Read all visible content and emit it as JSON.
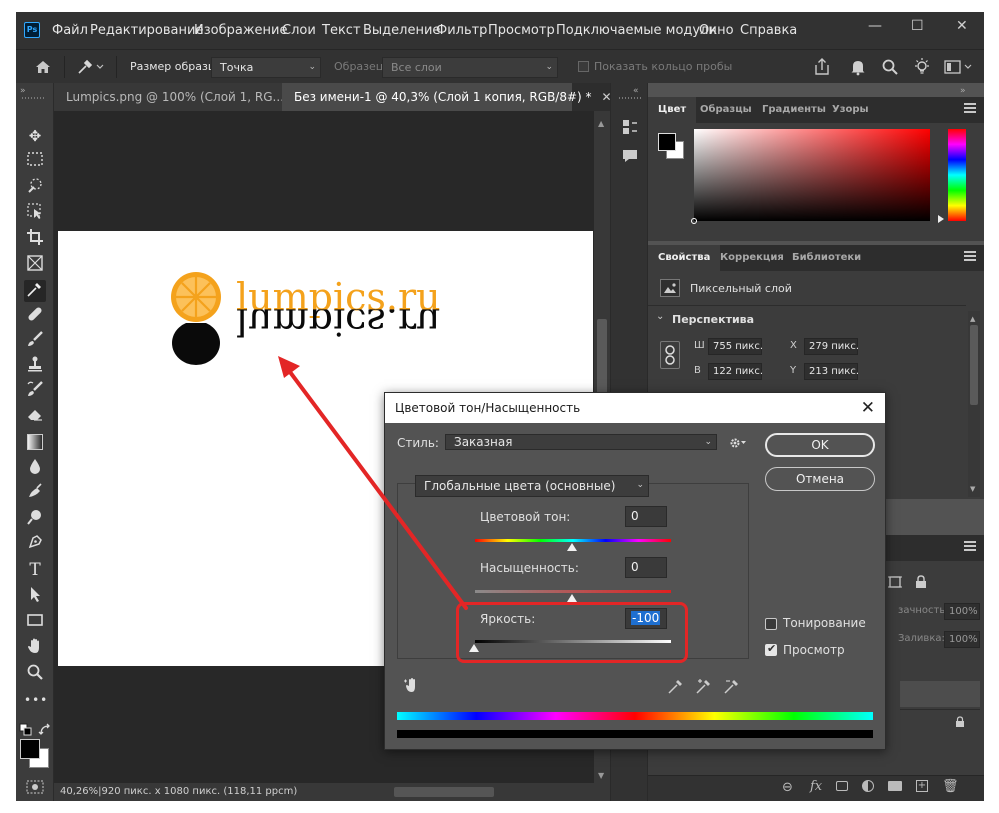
{
  "menubar": {
    "app_icon": "Ps",
    "items": [
      "Файл",
      "Редактирование",
      "Изображение",
      "Слои",
      "Текст",
      "Выделение",
      "Фильтр",
      "Просмотр",
      "Подключаемые модули",
      "Окно",
      "Справка"
    ],
    "window_controls": [
      "—",
      "☐",
      "✕"
    ]
  },
  "options": {
    "sample_size_label": "Размер образца:",
    "sample_size_value": "Точка",
    "sample_label": "Образец:",
    "sample_value": "Все слои",
    "show_ring_label": "Показать кольцо пробы"
  },
  "tabs": [
    {
      "label": "Lumpics.png @ 100% (Слой 1, RG...",
      "close": "✕"
    },
    {
      "label": "Без имени-1 @ 40,3% (Слой 1 копия, RGB/8#) *",
      "close": "✕"
    }
  ],
  "canvas": {
    "logo_text": "lumpics.ru",
    "logo_color": "#f4a21c",
    "mirror_color": "#0a0a0a"
  },
  "statusbar": {
    "text": "40,26%|920 пикс. x 1080 пикс. (118,11 ppcm)"
  },
  "color_panel": {
    "tabs": [
      "Цвет",
      "Образцы",
      "Градиенты",
      "Узоры"
    ]
  },
  "properties_panel": {
    "tabs": [
      "Свойства",
      "Коррекция",
      "Библиотеки"
    ],
    "layer_type": "Пиксельный слой",
    "section": "Перспектива",
    "w_label": "Ш",
    "w_value": "755 пикс.",
    "x_label": "X",
    "x_value": "279 пикс.",
    "h_label": "В",
    "h_value": "122 пикс.",
    "y_label": "Y",
    "y_value": "213 пикс."
  },
  "layers_panel": {
    "opacity_label": "зачность:",
    "opacity_value": "100%",
    "fill_label": "Заливка:",
    "fill_value": "100%"
  },
  "dialog": {
    "title": "Цветовой тон/Насыщенность",
    "close": "✕",
    "style_label": "Стиль:",
    "style_value": "Заказная",
    "ok": "OK",
    "cancel": "Отмена",
    "range_value": "Глобальные цвета (основные)",
    "hue_label": "Цветовой тон:",
    "hue_value": "0",
    "saturation_label": "Насыщенность:",
    "saturation_value": "0",
    "lightness_label": "Яркость:",
    "lightness_value": "-100",
    "colorize_label": "Тонирование",
    "colorize_checked": false,
    "preview_label": "Просмотр",
    "preview_checked": true
  },
  "annotation": {
    "color": "#e32626"
  }
}
